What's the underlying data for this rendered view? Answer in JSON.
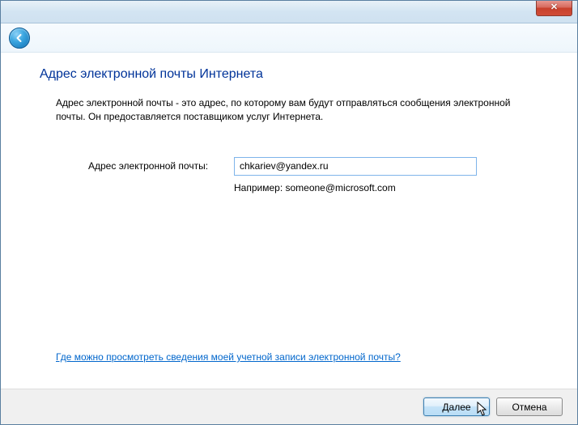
{
  "titlebar": {
    "close_glyph": "✕"
  },
  "page": {
    "title": "Адрес электронной почты Интернета",
    "description": "Адрес электронной почты - это адрес, по которому вам будут отправляться сообщения электронной почты. Он предоставляется поставщиком услуг Интернета."
  },
  "form": {
    "email_label": "Адрес электронной почты:",
    "email_value": "chkariev@yandex.ru",
    "example_text": "Например: someone@microsoft.com"
  },
  "help": {
    "link_text": "Где можно просмотреть сведения моей учетной записи электронной почты?"
  },
  "footer": {
    "next_label": "Далее",
    "cancel_label": "Отмена"
  }
}
